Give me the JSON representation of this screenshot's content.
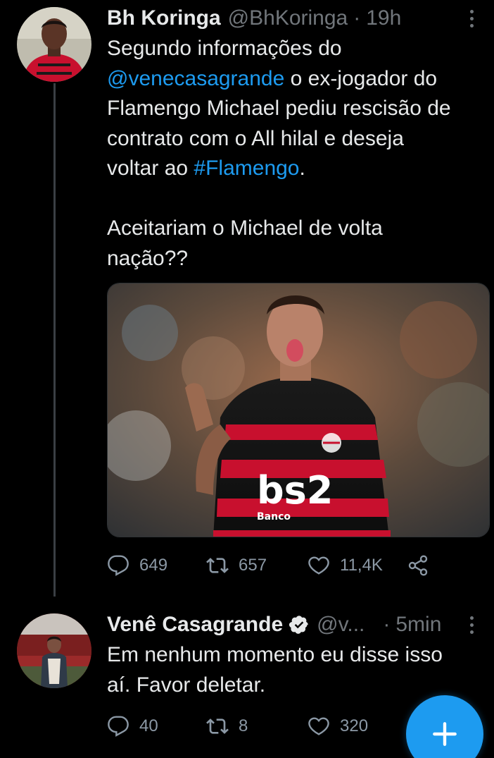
{
  "tweet1": {
    "name": "Bh Koringa",
    "handle": "@BhKoringa",
    "separator": "·",
    "time": "19h",
    "text_part1": "Segundo informações do\n",
    "mention": "@venecasagrande",
    "text_part2": " o ex-jogador do\nFlamengo Michael pediu rescisão de\ncontrato com o All hilal e deseja\nvoltar ao ",
    "hashtag": "#Flamengo",
    "text_part3": ".\n\nAceitariam o Michael de volta\nnação??",
    "replies": "649",
    "retweets": "657",
    "likes": "11,4K",
    "media_sponsor_text": "bs2",
    "media_sponsor_sub": "Banco"
  },
  "tweet2": {
    "name": "Venê Casagrande",
    "handle": "@v...",
    "separator": "·",
    "time": "5min",
    "text": "Em nenhum momento eu disse isso\naí. Favor deletar.",
    "replies": "40",
    "retweets": "8",
    "likes": "320"
  },
  "icons": {
    "reply": "reply-icon",
    "retweet": "retweet-icon",
    "like": "heart-icon",
    "share": "share-icon",
    "verified": "verified-badge-icon",
    "compose": "compose-plus-icon",
    "more": "more-icon"
  },
  "colors": {
    "background": "#000000",
    "text": "#e7e9ea",
    "muted": "#71767b",
    "link": "#1d9bf0",
    "fab": "#1d9bf0"
  }
}
